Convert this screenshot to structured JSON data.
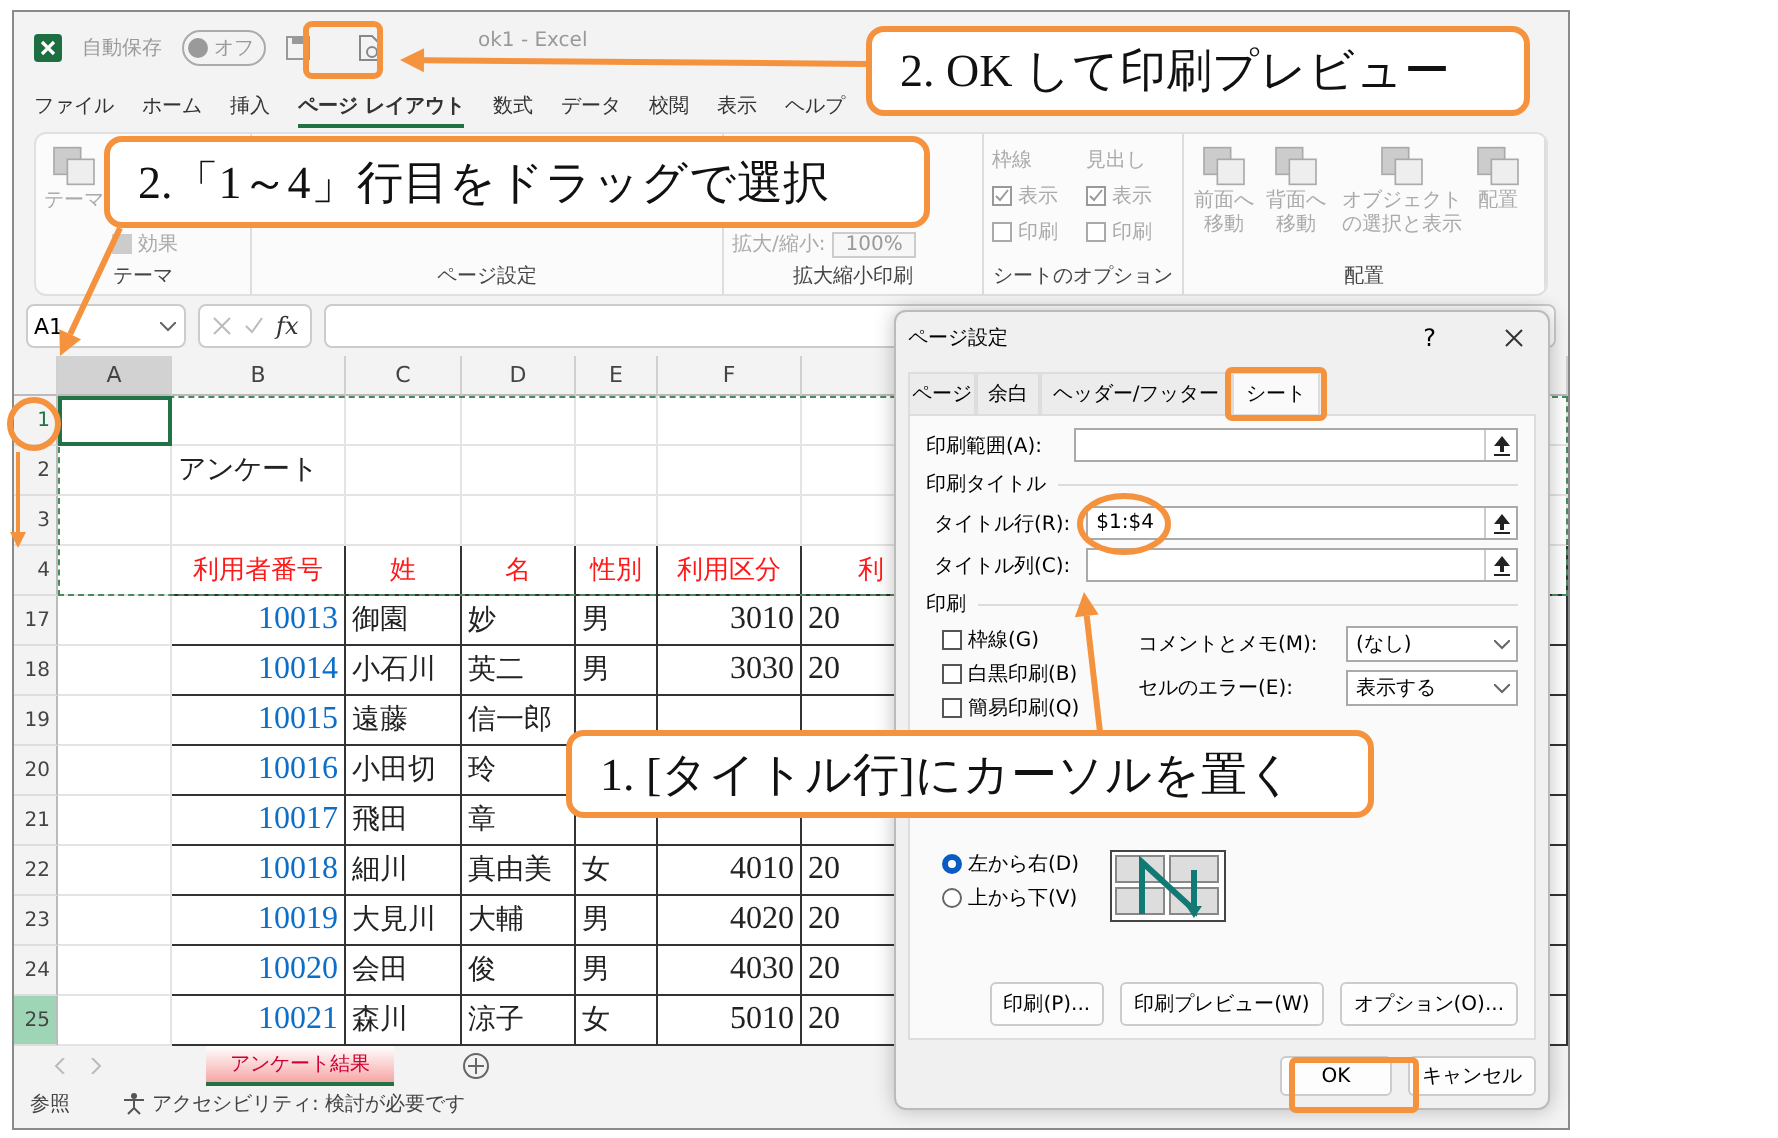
{
  "window": {
    "title": "ok1 - Excel",
    "autosave_label": "自動保存",
    "autosave_state": "オフ"
  },
  "menu": [
    {
      "label": "ファイル",
      "selected": false
    },
    {
      "label": "ホーム",
      "selected": false
    },
    {
      "label": "挿入",
      "selected": false
    },
    {
      "label": "ページ レイアウト",
      "selected": true
    },
    {
      "label": "数式",
      "selected": false
    },
    {
      "label": "データ",
      "selected": false
    },
    {
      "label": "校閲",
      "selected": false
    },
    {
      "label": "表示",
      "selected": false
    },
    {
      "label": "ヘルプ",
      "selected": false
    }
  ],
  "ribbon": {
    "groups": [
      {
        "label": "テーマ",
        "columns": [
          [
            {
              "kind": "big",
              "label": "テーマ"
            }
          ],
          [
            {
              "kind": "small",
              "label": "効果"
            }
          ]
        ]
      },
      {
        "label": "ページ設定"
      },
      {
        "label": "拡大縮小印刷",
        "columns": [
          [
            {
              "kind": "spin",
              "label": "拡大/縮小:",
              "value": "100%"
            }
          ]
        ]
      },
      {
        "label": "シートのオプション",
        "columns": [
          [
            {
              "kind": "heading",
              "label": "枠線"
            },
            {
              "kind": "check",
              "label": "表示",
              "checked": true
            },
            {
              "kind": "check",
              "label": "印刷",
              "checked": false
            }
          ],
          [
            {
              "kind": "heading",
              "label": "見出し"
            },
            {
              "kind": "check",
              "label": "表示",
              "checked": true
            },
            {
              "kind": "check",
              "label": "印刷",
              "checked": false
            }
          ]
        ]
      },
      {
        "label": "配置",
        "columns": [
          [
            {
              "kind": "big",
              "label": "前面へ移動"
            }
          ],
          [
            {
              "kind": "big",
              "label": "背面へ移動"
            }
          ],
          [
            {
              "kind": "big",
              "label": "オブジェクトの選択と表示"
            }
          ],
          [
            {
              "kind": "big",
              "label": "配置"
            }
          ]
        ]
      }
    ]
  },
  "formula_bar": {
    "name_box": "A1",
    "fx": "fx"
  },
  "sheet": {
    "columns": [
      {
        "label": "A",
        "selected": true
      },
      {
        "label": "B",
        "selected": false
      },
      {
        "label": "C",
        "selected": false
      },
      {
        "label": "D",
        "selected": false
      },
      {
        "label": "E",
        "selected": false
      },
      {
        "label": "F",
        "selected": false
      }
    ],
    "rows": [
      {
        "num": "1",
        "selected": true,
        "highlighted": false,
        "kind": "blank",
        "cells": {}
      },
      {
        "num": "2",
        "selected": false,
        "highlighted": false,
        "kind": "title",
        "cells": {
          "b": "アンケート"
        }
      },
      {
        "num": "3",
        "selected": false,
        "highlighted": false,
        "kind": "blank",
        "cells": {}
      },
      {
        "num": "4",
        "selected": false,
        "highlighted": false,
        "kind": "header",
        "cells": {
          "b": "利用者番号",
          "c": "姓",
          "d": "名",
          "e": "性別",
          "f": "利用区分",
          "g": "利"
        }
      },
      {
        "num": "17",
        "selected": false,
        "highlighted": false,
        "kind": "data",
        "cells": {
          "b": "10013",
          "c": "御園",
          "d": "妙",
          "e": "男",
          "f": "3010",
          "g": "20"
        }
      },
      {
        "num": "18",
        "selected": false,
        "highlighted": false,
        "kind": "data",
        "cells": {
          "b": "10014",
          "c": "小石川",
          "d": "英二",
          "e": "男",
          "f": "3030",
          "g": "20"
        }
      },
      {
        "num": "19",
        "selected": false,
        "highlighted": false,
        "kind": "data",
        "cells": {
          "b": "10015",
          "c": "遠藤",
          "d": "信一郎"
        }
      },
      {
        "num": "20",
        "selected": false,
        "highlighted": false,
        "kind": "data",
        "cells": {
          "b": "10016",
          "c": "小田切",
          "d": "玲"
        }
      },
      {
        "num": "21",
        "selected": false,
        "highlighted": false,
        "kind": "data",
        "cells": {
          "b": "10017",
          "c": "飛田",
          "d": "章"
        }
      },
      {
        "num": "22",
        "selected": false,
        "highlighted": false,
        "kind": "data",
        "cells": {
          "b": "10018",
          "c": "細川",
          "d": "真由美",
          "e": "女",
          "f": "4010",
          "g": "20"
        }
      },
      {
        "num": "23",
        "selected": false,
        "highlighted": false,
        "kind": "data",
        "cells": {
          "b": "10019",
          "c": "大見川",
          "d": "大輔",
          "e": "男",
          "f": "4020",
          "g": "20"
        }
      },
      {
        "num": "24",
        "selected": false,
        "highlighted": false,
        "kind": "data",
        "cells": {
          "b": "10020",
          "c": "会田",
          "d": "俊",
          "e": "男",
          "f": "4030",
          "g": "20"
        }
      },
      {
        "num": "25",
        "selected": false,
        "highlighted": true,
        "kind": "data",
        "cells": {
          "b": "10021",
          "c": "森川",
          "d": "涼子",
          "e": "女",
          "f": "5010",
          "g": "20"
        }
      }
    ]
  },
  "sheet_tabs": [
    {
      "label": "アンケート結果",
      "selected": true
    }
  ],
  "status_bar": {
    "mode": "参照",
    "accessibility": "アクセシビリティ: 検討が必要です"
  },
  "dialog": {
    "title": "ページ設定",
    "help": "?",
    "tabs": [
      {
        "label": "ページ",
        "selected": false
      },
      {
        "label": "余白",
        "selected": false
      },
      {
        "label": "ヘッダー/フッター",
        "selected": false
      },
      {
        "label": "シート",
        "selected": true
      }
    ],
    "print_area": {
      "label": "印刷範囲(A):"
    },
    "print_titles": {
      "label": "印刷タイトル",
      "rows": {
        "label": "タイトル行(R):",
        "value": "$1:$4"
      },
      "columns": {
        "label": "タイトル列(C):"
      }
    },
    "print": {
      "label": "印刷",
      "checkboxes": [
        {
          "label": "枠線(G)",
          "checked": false
        },
        {
          "label": "白黒印刷(B)",
          "checked": false
        },
        {
          "label": "簡易印刷(Q)",
          "checked": false
        }
      ],
      "selects": [
        {
          "label": "コメントとメモ(M):",
          "value": "(なし)"
        },
        {
          "label": "セルのエラー(E):",
          "value": "表示する"
        }
      ]
    },
    "page_order": {
      "options": [
        {
          "label": "左から右(D)",
          "selected": true
        },
        {
          "label": "上から下(V)",
          "selected": false
        }
      ]
    },
    "buttons": [
      {
        "label": "印刷(P)..."
      },
      {
        "label": "印刷プレビュー(W)"
      },
      {
        "label": "オプション(O)..."
      }
    ],
    "footer_buttons": [
      {
        "label": "OK"
      },
      {
        "label": "キャンセル"
      }
    ]
  },
  "callouts": [
    {
      "text": "2. OK して印刷プレビュー"
    },
    {
      "text": "2.「1～4」行目をドラッグで選択"
    },
    {
      "text": "1. [タイトル行]にカーソルを置く"
    }
  ]
}
